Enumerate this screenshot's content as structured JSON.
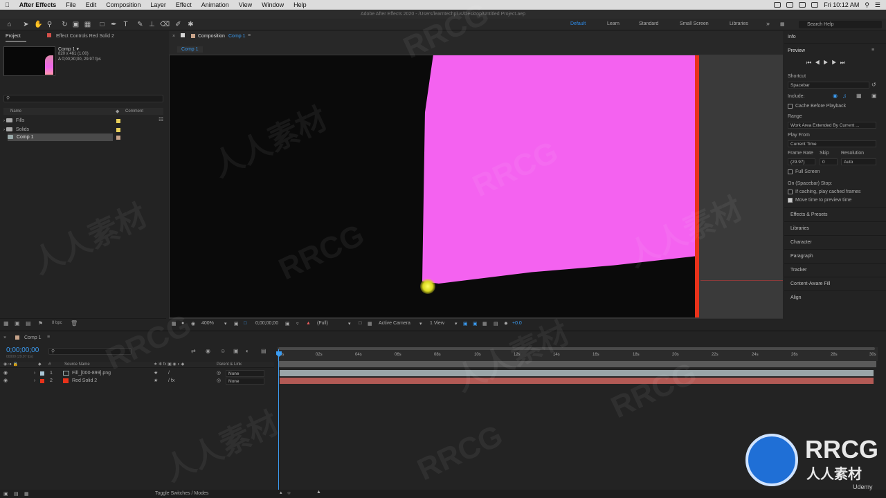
{
  "menubar": {
    "app": "After Effects",
    "items": [
      "File",
      "Edit",
      "Composition",
      "Layer",
      "Effect",
      "Animation",
      "View",
      "Window",
      "Help"
    ],
    "clock": "Fri 10:12 AM"
  },
  "window_title": "Adobe After Effects 2020 - /Users/learntechplus/Desktop/Untitled Project.aep",
  "workspaces": {
    "default": "Default",
    "learn": "Learn",
    "standard": "Standard",
    "small_screen": "Small Screen",
    "libraries": "Libraries"
  },
  "search_help": "Search Help",
  "project": {
    "tab": "Project",
    "effect_controls_tab": "Effect Controls Red Solid 2",
    "comp_name": "Comp 1 ▾",
    "comp_size": "820 x 461 (1.00)",
    "comp_duration": "Δ 0;00;30;00, 29.97 fps",
    "col_name": "Name",
    "col_comment": "Comment",
    "items": [
      {
        "name": "Fills",
        "type": "folder",
        "color": "#e8cf5a"
      },
      {
        "name": "Solids",
        "type": "folder",
        "color": "#e8cf5a"
      },
      {
        "name": "Comp 1",
        "type": "comp",
        "color": "#c7a38a"
      }
    ],
    "bpc": "8 bpc"
  },
  "composition": {
    "tab_prefix": "Composition",
    "tab_name": "Comp 1",
    "crumb": "Comp 1",
    "zoom": "400%",
    "timecode": "0;00;00;00",
    "resolution": "(Full)",
    "camera": "Active Camera",
    "views": "1 View",
    "exposure": "+0.0"
  },
  "right_panel": {
    "info": "Info",
    "preview": "Preview",
    "shortcut_label": "Shortcut",
    "shortcut": "Spacebar",
    "include": "Include:",
    "cache_before": "Cache Before Playback",
    "range_label": "Range",
    "range": "Work Area Extended By Current ...",
    "play_from_label": "Play From",
    "play_from": "Current Time",
    "frame_rate_label": "Frame Rate",
    "skip_label": "Skip",
    "resolution_label": "Resolution",
    "frame_rate": "(29.97)",
    "skip": "0",
    "resolution": "Auto",
    "full_screen": "Full Screen",
    "stop_label": "On (Spacebar) Stop:",
    "if_caching": "If caching, play cached frames",
    "move_time": "Move time to preview time",
    "sections": [
      "Effects & Presets",
      "Libraries",
      "Character",
      "Paragraph",
      "Tracker",
      "Content-Aware Fill",
      "Align"
    ]
  },
  "timeline": {
    "comp_tab": "Comp 1",
    "timecode": "0;00;00;00",
    "sub_tc": "00000 (29.97 fps)",
    "col_num": "#",
    "col_source": "Source Name",
    "col_parent": "Parent & Link",
    "layers": [
      {
        "num": "1",
        "name": "Fill_[000-899].png",
        "parent": "None",
        "color": "#aac7d6",
        "bar": "#9aa5a8"
      },
      {
        "num": "2",
        "name": "Red Solid 2",
        "parent": "None",
        "color": "#e8321a",
        "bar": "#b25a55"
      }
    ],
    "ticks": [
      "0s",
      "02s",
      "04s",
      "06s",
      "08s",
      "10s",
      "12s",
      "14s",
      "16s",
      "18s",
      "20s",
      "22s",
      "24s",
      "26s",
      "28s",
      "30s"
    ],
    "toggle": "Toggle Switches / Modes"
  },
  "watermark": {
    "brand": "RRCG",
    "cn": "人人素材",
    "udemy": "Udemy"
  }
}
